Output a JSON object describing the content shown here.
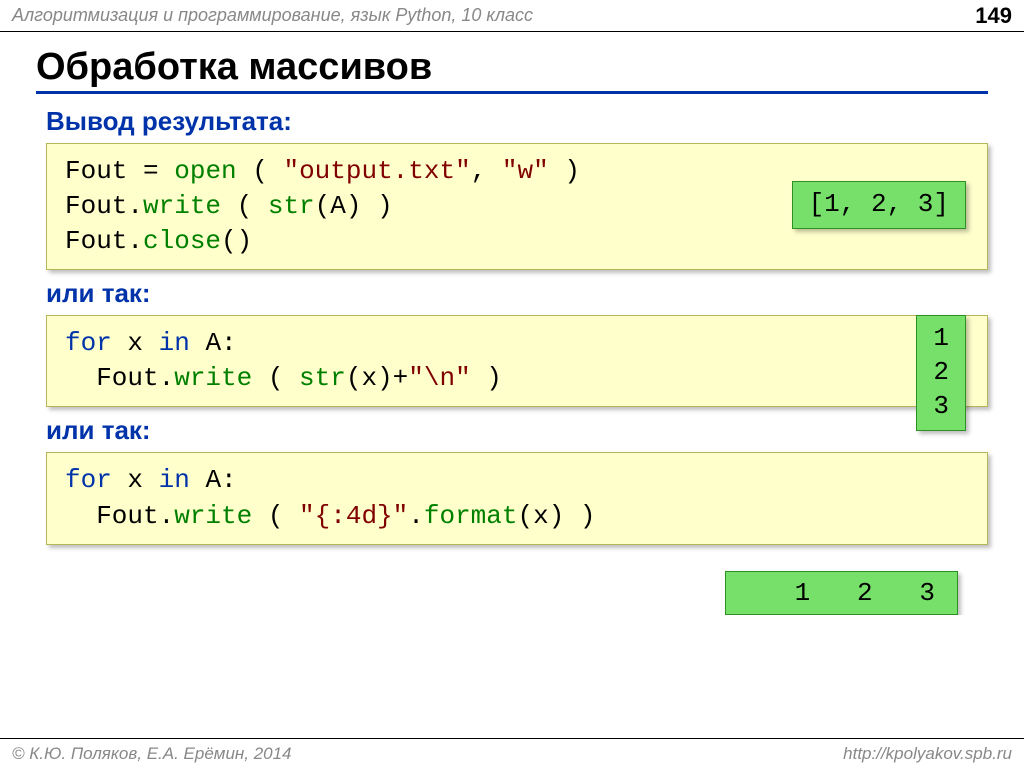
{
  "header": {
    "breadcrumb": "Алгоритмизация и программирование, язык Python, 10 класс",
    "page": "149"
  },
  "title": "Обработка массивов",
  "sub1": "Вывод результата:",
  "code1": {
    "l1a": "Fout",
    "l1b": " = ",
    "l1c": "open",
    "l1d": " ( ",
    "l1e": "\"output.txt\"",
    "l1f": ", ",
    "l1g": "\"w\"",
    "l1h": " )",
    "l2a": "Fout.",
    "l2b": "write",
    "l2c": " ( ",
    "l2d": "str",
    "l2e": "(A) )",
    "l3a": "Fout.",
    "l3b": "close",
    "l3c": "()"
  },
  "out1": "[1, 2, 3]",
  "sub2": "или так:",
  "code2": {
    "l1a": "for",
    "l1b": " x ",
    "l1c": "in",
    "l1d": " A:",
    "l2a": "  Fout.",
    "l2b": "write",
    "l2c": " ( ",
    "l2d": "str",
    "l2e": "(x)+",
    "l2f": "\"\\n\"",
    "l2g": " )"
  },
  "out2": "1\n2\n3",
  "sub3": "или так:",
  "code3": {
    "l1a": "for",
    "l1b": " x ",
    "l1c": "in",
    "l1d": " A:",
    "l2a": "  Fout.",
    "l2b": "write",
    "l2c": " ( ",
    "l2d": "\"{:4d}\"",
    "l2e": ".",
    "l2f": "format",
    "l2g": "(x) )"
  },
  "out3": "   1   2   3",
  "footer": {
    "left": "© К.Ю. Поляков, Е.А. Ерёмин, 2014",
    "right": "http://kpolyakov.spb.ru"
  }
}
